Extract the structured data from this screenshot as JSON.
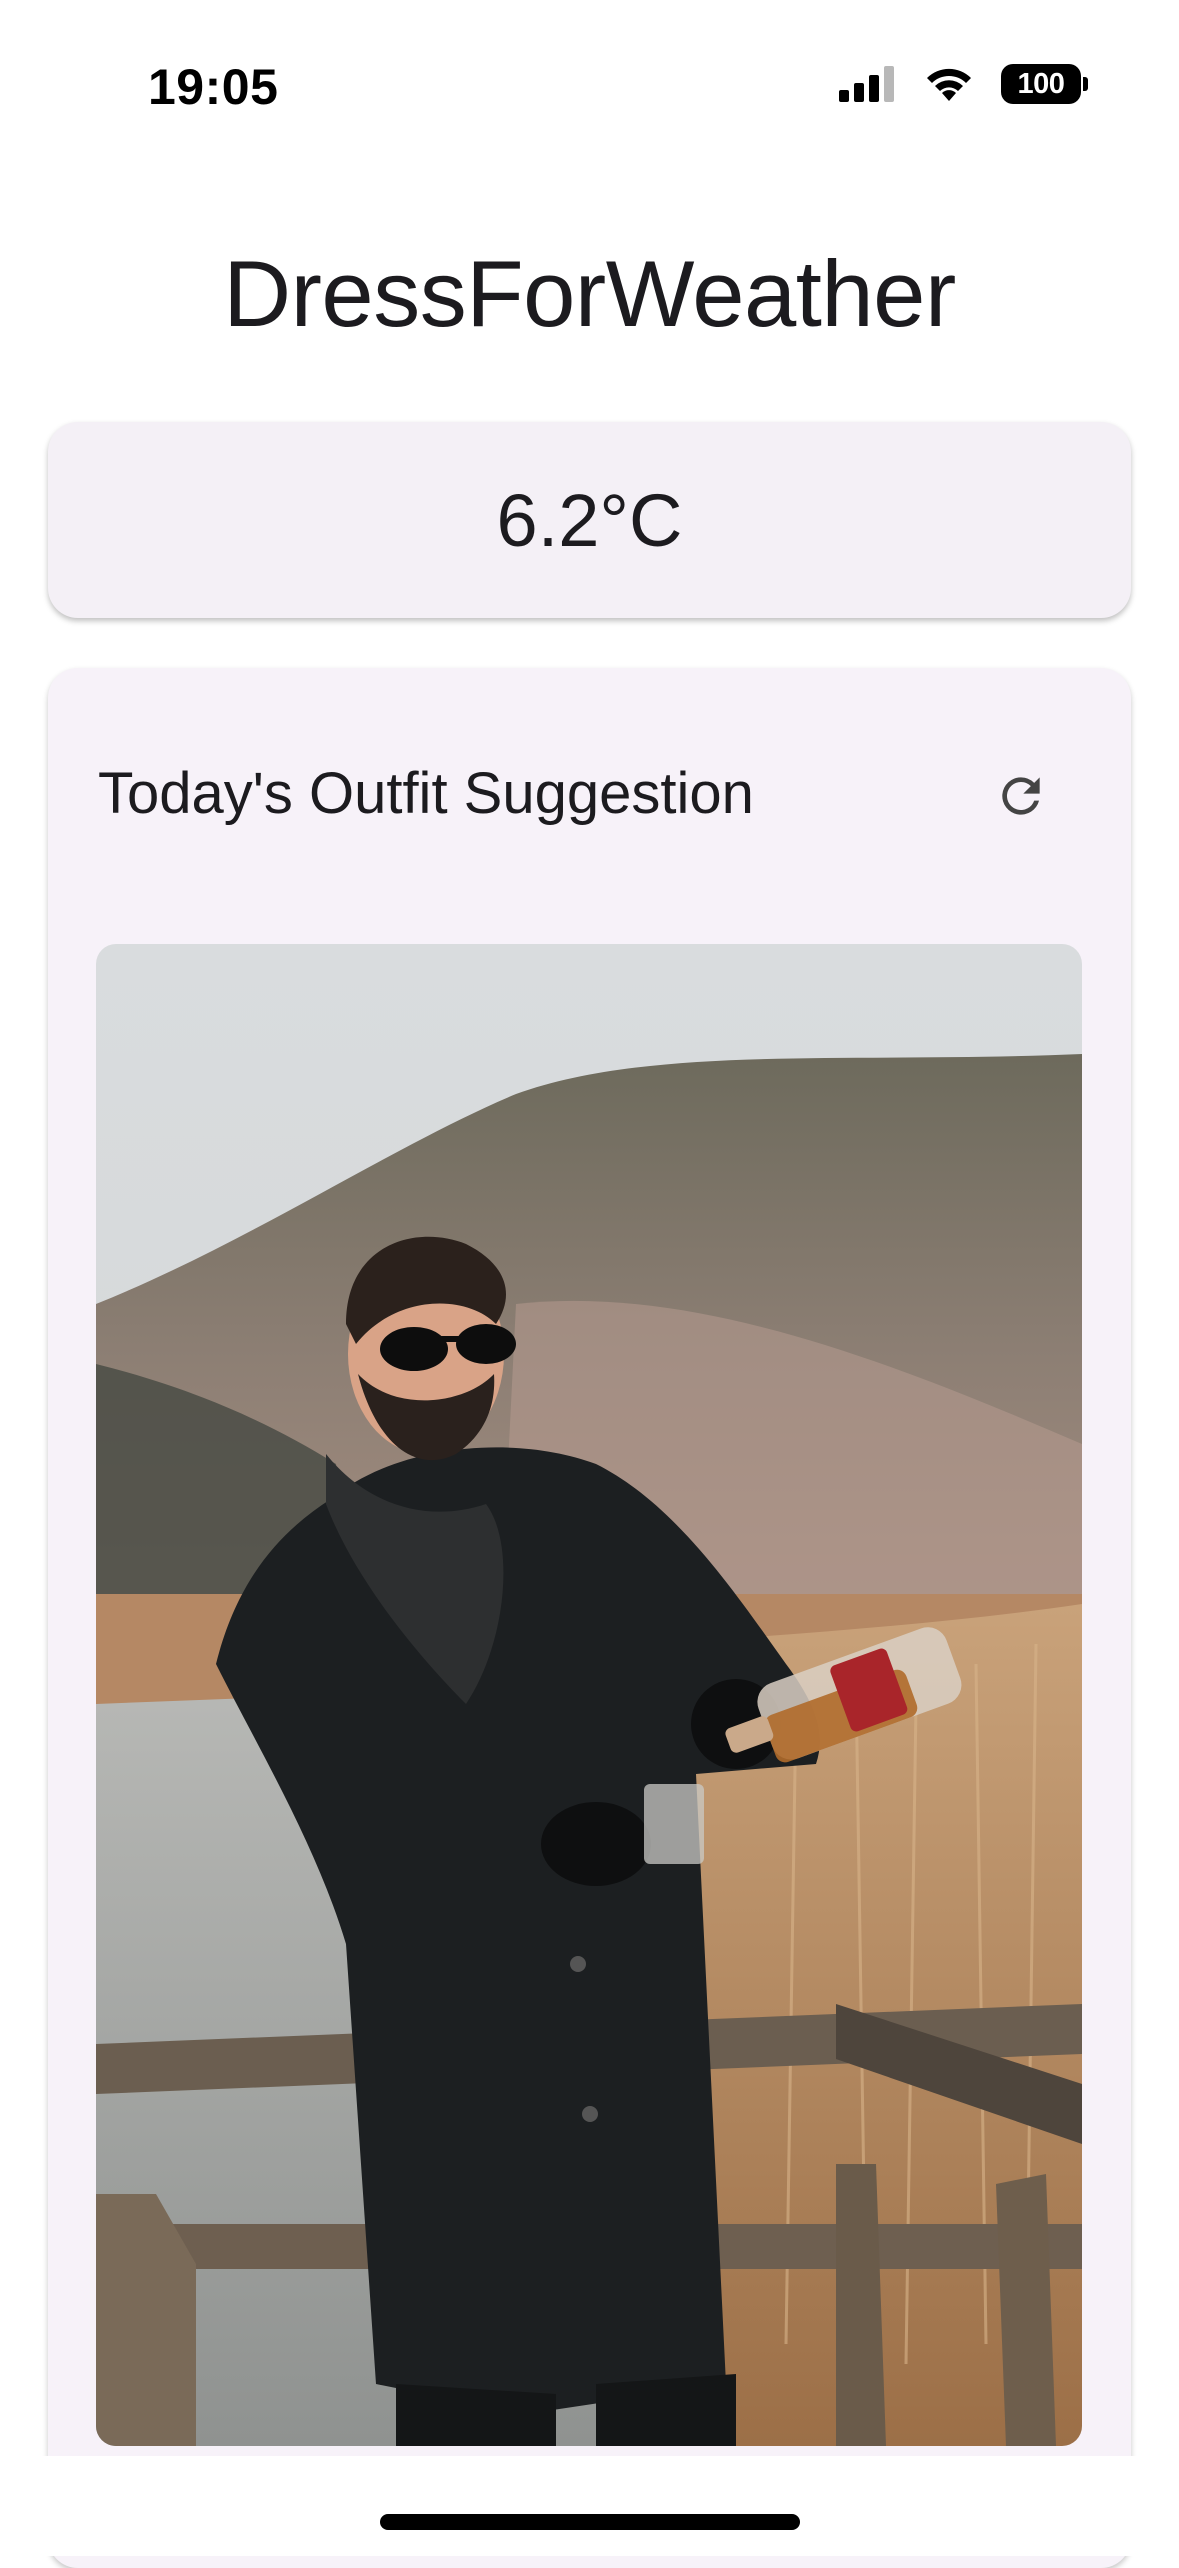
{
  "status_bar": {
    "time": "19:05",
    "battery": "100",
    "icons": [
      "cellular-signal-icon",
      "wifi-icon",
      "battery-icon"
    ]
  },
  "app": {
    "title": "DressForWeather"
  },
  "weather": {
    "temperature": "6.2°C"
  },
  "outfit": {
    "heading": "Today's Outfit Suggestion",
    "refresh_icon": "refresh-icon"
  },
  "colors": {
    "card_background": "#f4f0f6",
    "text": "#1c1b1f"
  }
}
